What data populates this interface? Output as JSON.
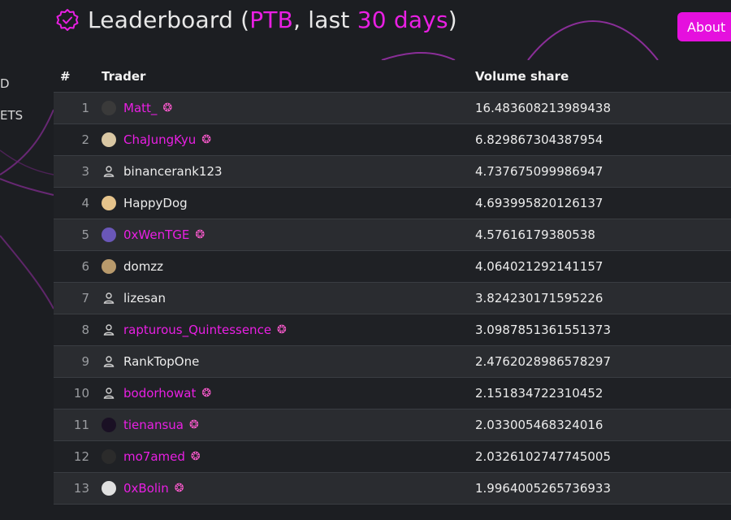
{
  "sidebar_fragments": [
    "D",
    "ETS"
  ],
  "header": {
    "title_prefix": "Leaderboard (",
    "token": "PTB",
    "title_mid": ", last ",
    "period": "30 days",
    "title_suffix": ")",
    "about_label": "About"
  },
  "table": {
    "col_rank": "#",
    "col_trader": "Trader",
    "col_volume": "Volume share",
    "rows": [
      {
        "rank": "1",
        "name": "Matt_",
        "volume": "16.483608213989438",
        "linked": true,
        "avatar": "photo-dark",
        "color": "#3a3a3a"
      },
      {
        "rank": "2",
        "name": "ChaJungKyu",
        "volume": "6.829867304387954",
        "linked": true,
        "avatar": "photo-light",
        "color": "#d9c7a3"
      },
      {
        "rank": "3",
        "name": "binancerank123",
        "volume": "4.737675099986947",
        "linked": false,
        "avatar": "person",
        "color": ""
      },
      {
        "rank": "4",
        "name": "HappyDog",
        "volume": "4.693995820126137",
        "linked": false,
        "avatar": "photo-light",
        "color": "#e6c48c"
      },
      {
        "rank": "5",
        "name": "0xWenTGE",
        "volume": "4.57616179380538",
        "linked": true,
        "avatar": "photo-dark",
        "color": "#6a57b8"
      },
      {
        "rank": "6",
        "name": "domzz",
        "volume": "4.06402129214115 7",
        "linked": false,
        "avatar": "photo-light",
        "color": "#b89a6c"
      },
      {
        "rank": "7",
        "name": "lizesan",
        "volume": "3.824230171595226",
        "linked": false,
        "avatar": "person",
        "color": ""
      },
      {
        "rank": "8",
        "name": "rapturous_Quintessence",
        "volume": "3.0987851361551373",
        "linked": true,
        "avatar": "person",
        "color": ""
      },
      {
        "rank": "9",
        "name": "RankTopOne",
        "volume": "2.4762028986578297",
        "linked": false,
        "avatar": "person",
        "color": ""
      },
      {
        "rank": "10",
        "name": "bodorhowat",
        "volume": "2.151834722310452",
        "linked": true,
        "avatar": "person",
        "color": ""
      },
      {
        "rank": "11",
        "name": "tienansua",
        "volume": "2.033005468324016",
        "linked": true,
        "avatar": "photo-dark",
        "color": "#1a1024"
      },
      {
        "rank": "12",
        "name": "mo7amed",
        "volume": "2.0326102747745005",
        "linked": true,
        "avatar": "photo-dark",
        "color": "#2b2b2b"
      },
      {
        "rank": "13",
        "name": "0xBolin",
        "volume": "1.9964005265736933",
        "linked": true,
        "avatar": "photo-light",
        "color": "#e0e0e0"
      }
    ]
  },
  "colors": {
    "accent": "#e91fe3",
    "background": "#1c1e22",
    "row_alt": "#2a2c30"
  },
  "icons": {
    "title": "verified-badge-icon",
    "jelly": "jellyfish-icon",
    "person": "person-icon"
  }
}
